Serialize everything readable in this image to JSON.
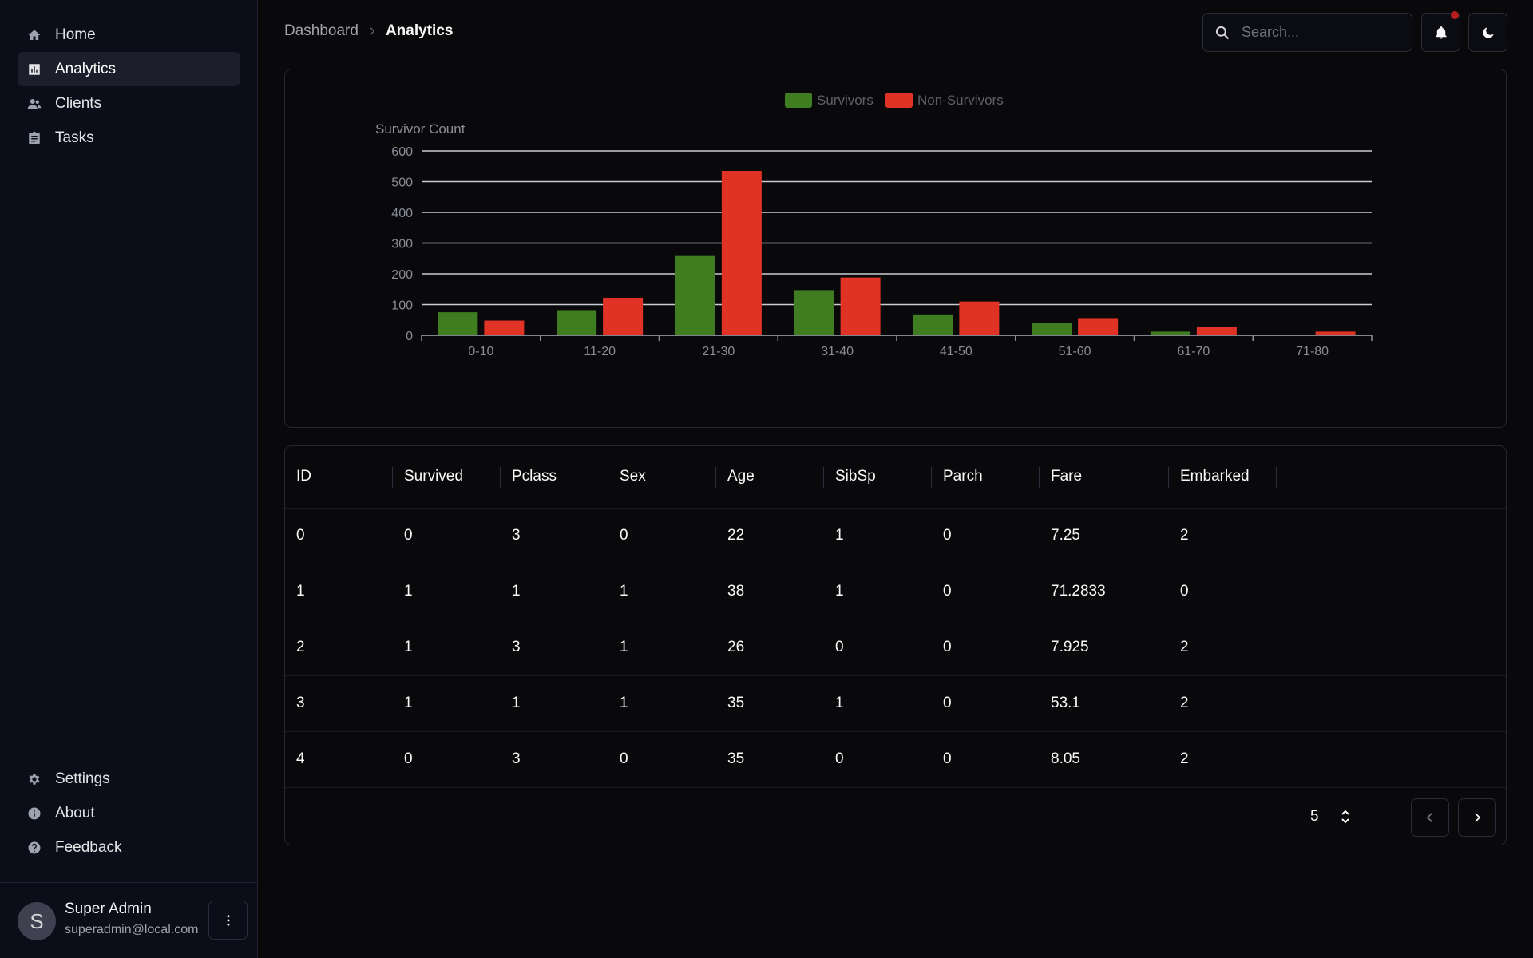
{
  "sidebar": {
    "top_items": [
      {
        "label": "Home",
        "icon": "home-icon",
        "active": false
      },
      {
        "label": "Analytics",
        "icon": "bar-chart-icon",
        "active": true
      },
      {
        "label": "Clients",
        "icon": "users-icon",
        "active": false
      },
      {
        "label": "Tasks",
        "icon": "clipboard-icon",
        "active": false
      }
    ],
    "bottom_items": [
      {
        "label": "Settings",
        "icon": "gear-icon"
      },
      {
        "label": "About",
        "icon": "info-icon"
      },
      {
        "label": "Feedback",
        "icon": "help-icon"
      }
    ],
    "user": {
      "initial": "S",
      "name": "Super Admin",
      "email": "superadmin@local.com"
    }
  },
  "header": {
    "breadcrumb": {
      "parent": "Dashboard",
      "current": "Analytics"
    },
    "search_placeholder": "Search..."
  },
  "colors": {
    "survivors": "#3f7d20",
    "non_survivors": "#e03325",
    "background": "#09090b"
  },
  "chart_data": {
    "type": "bar",
    "ylabel": "Survivor Count",
    "categories": [
      "0-10",
      "11-20",
      "21-30",
      "31-40",
      "41-50",
      "51-60",
      "61-70",
      "71-80"
    ],
    "series": [
      {
        "name": "Survivors",
        "color": "#3f7d20",
        "values": [
          75,
          82,
          258,
          147,
          68,
          40,
          12,
          2
        ]
      },
      {
        "name": "Non-Survivors",
        "color": "#e03325",
        "values": [
          48,
          122,
          535,
          188,
          110,
          56,
          27,
          12
        ]
      }
    ],
    "ylim": [
      0,
      600
    ],
    "yticks": [
      0,
      100,
      200,
      300,
      400,
      500,
      600
    ],
    "grid": true,
    "legend": "top-center"
  },
  "table": {
    "columns": [
      "ID",
      "Survived",
      "Pclass",
      "Sex",
      "Age",
      "SibSp",
      "Parch",
      "Fare",
      "Embarked"
    ],
    "rows": [
      [
        "0",
        "0",
        "3",
        "0",
        "22",
        "1",
        "0",
        "7.25",
        "2"
      ],
      [
        "1",
        "1",
        "1",
        "1",
        "38",
        "1",
        "0",
        "71.2833",
        "0"
      ],
      [
        "2",
        "1",
        "3",
        "1",
        "26",
        "0",
        "0",
        "7.925",
        "2"
      ],
      [
        "3",
        "1",
        "1",
        "1",
        "35",
        "1",
        "0",
        "53.1",
        "2"
      ],
      [
        "4",
        "0",
        "3",
        "0",
        "35",
        "0",
        "0",
        "8.05",
        "2"
      ]
    ],
    "page_size": "5"
  }
}
